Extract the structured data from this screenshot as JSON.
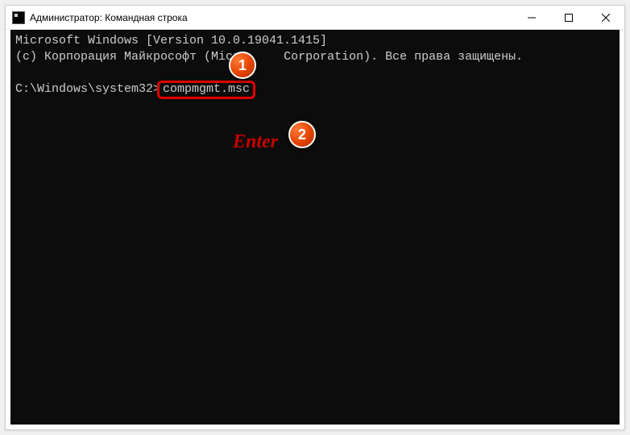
{
  "window": {
    "title": "Администратор: Командная строка"
  },
  "console": {
    "line1": "Microsoft Windows [Version 10.0.19041.1415]",
    "line2_a": "(c) Корпорация Майкрософт (Micro",
    "line2_b": "Corporation). Все права защищены.",
    "prompt": "C:\\Windows\\system32>",
    "command": "compmgmt.msc"
  },
  "annotations": {
    "badge1": "1",
    "badge2": "2",
    "enter_label": "Enter"
  }
}
